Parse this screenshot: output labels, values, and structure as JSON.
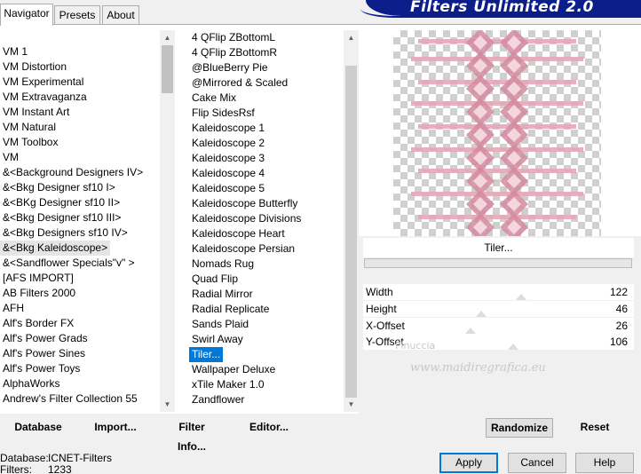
{
  "tabs": [
    "Navigator",
    "Presets",
    "About"
  ],
  "app_title": "Filters Unlimited 2.0",
  "categories": [
    "VM 1",
    "VM Distortion",
    "VM Experimental",
    "VM Extravaganza",
    "VM Instant Art",
    "VM Natural",
    "VM Toolbox",
    "VM",
    "&<Background Designers IV>",
    "&<Bkg Designer sf10 I>",
    "&<BKg Designer sf10 II>",
    "&<Bkg Designer sf10 III>",
    "&<Bkg Designers sf10 IV>",
    "&<Bkg Kaleidoscope>",
    "&<Sandflower Specials\"v\" >",
    "[AFS IMPORT]",
    "AB Filters 2000",
    "AFH",
    "Alf's Border FX",
    "Alf's Power Grads",
    "Alf's Power Sines",
    "Alf's Power Toys",
    "AlphaWorks",
    "Andrew's Filter Collection 55"
  ],
  "filters": [
    "4 QFlip ZBottomL",
    "4 QFlip ZBottomR",
    "@BlueBerry Pie",
    "@Mirrored & Scaled",
    "Cake Mix",
    "Flip SidesRsf",
    "Kaleidoscope 1",
    "Kaleidoscope 2",
    "Kaleidoscope 3",
    "Kaleidoscope 4",
    "Kaleidoscope 5",
    "Kaleidoscope Butterfly",
    "Kaleidoscope Divisions",
    "Kaleidoscope Heart",
    "Kaleidoscope Persian",
    "Nomads Rug",
    "Quad Flip",
    "Radial Mirror",
    "Radial Replicate",
    "Sands Plaid",
    "Swirl Away",
    "Tiler...",
    "Wallpaper Deluxe",
    "xTile Maker 1.0",
    "Zandflower"
  ],
  "selected_category_index": 13,
  "selected_filter_index": 21,
  "filter_name": "Tiler...",
  "params": [
    {
      "label": "Width",
      "value": "122",
      "level": 0.48
    },
    {
      "label": "Height",
      "value": "46",
      "level": 0.18
    },
    {
      "label": "X-Offset",
      "value": "26",
      "level": 0.1
    },
    {
      "label": "Y-Offset",
      "value": "106",
      "level": 0.42
    }
  ],
  "watermark": {
    "line1": "Pinuccia",
    "line2": "www.maidiregrafica.eu"
  },
  "buttons": {
    "database": "Database",
    "import": "Import...",
    "filter_info": "Filter Info...",
    "editor": "Editor...",
    "randomize": "Randomize",
    "reset": "Reset",
    "apply": "Apply",
    "cancel": "Cancel",
    "help": "Help"
  },
  "info": {
    "database_label": "Database:",
    "database_value": "ICNET-Filters",
    "filters_label": "Filters:",
    "filters_value": "1233"
  },
  "colors": {
    "selection": "#0078d7",
    "title_bar": "#0b1e8a",
    "preview_pink": "#d48aa0"
  },
  "icons": [
    "scroll-up-arrow-icon",
    "scroll-down-arrow-icon"
  ]
}
